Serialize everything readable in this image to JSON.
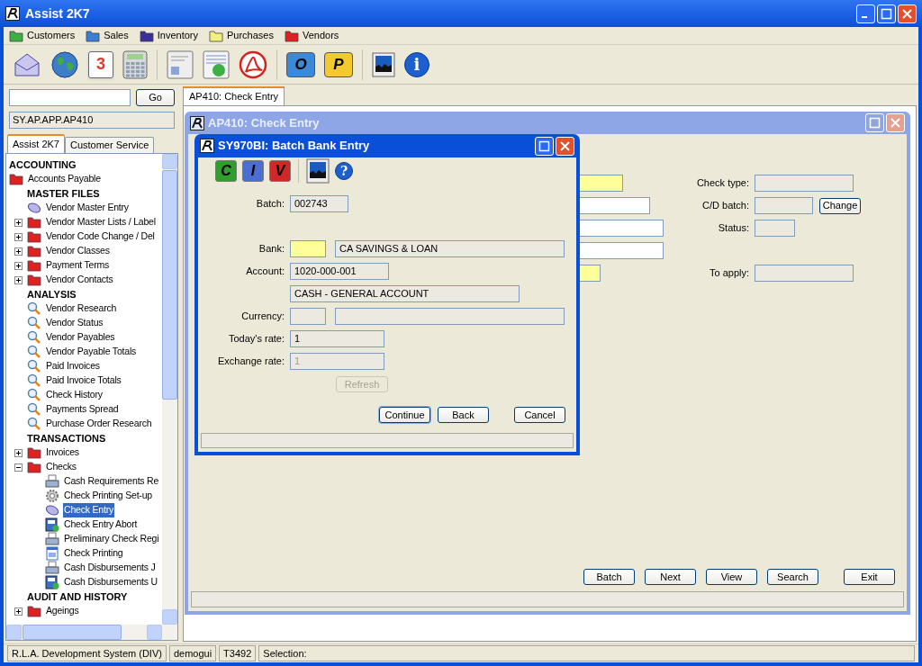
{
  "window": {
    "title": "Assist 2K7"
  },
  "menu": [
    {
      "label": "Customers",
      "color": "#3cb043"
    },
    {
      "label": "Sales",
      "color": "#3a7fd5"
    },
    {
      "label": "Inventory",
      "color": "#3b2f9c"
    },
    {
      "label": "Purchases",
      "color": "#f2ef7a"
    },
    {
      "label": "Vendors",
      "color": "#e02020"
    }
  ],
  "toolbar": [
    {
      "kind": "envelope"
    },
    {
      "kind": "globe"
    },
    {
      "kind": "calendar",
      "glyph": "3"
    },
    {
      "kind": "calculator"
    },
    {
      "kind": "card"
    },
    {
      "kind": "chart"
    },
    {
      "kind": "swirl"
    },
    {
      "kind": "folder",
      "glyph": "O"
    },
    {
      "kind": "folder",
      "glyph": "P"
    },
    {
      "kind": "picture"
    },
    {
      "kind": "info",
      "glyph": "i"
    }
  ],
  "search": {
    "button": "Go"
  },
  "path": "SY.AP.APP.AP410",
  "nav_tabs": [
    {
      "label": "Assist 2K7",
      "selected": true
    },
    {
      "label": "Customer Service",
      "selected": false
    }
  ],
  "tree": [
    {
      "label": "ACCOUNTING",
      "kind": "heading",
      "children": [
        {
          "label": "Accounts Payable",
          "kind": "folder",
          "selected": false,
          "children": [
            {
              "label": "MASTER FILES",
              "kind": "heading",
              "children": [
                {
                  "label": "Vendor Master Entry",
                  "kind": "entry",
                  "selected": false
                },
                {
                  "label": "Vendor Master Lists / Label",
                  "kind": "folder",
                  "selected": false,
                  "expanded": false
                },
                {
                  "label": "Vendor Code Change / Del",
                  "kind": "folder",
                  "selected": false,
                  "expanded": false
                },
                {
                  "label": "Vendor Classes",
                  "kind": "folder",
                  "selected": false,
                  "expanded": false
                },
                {
                  "label": "Payment Terms",
                  "kind": "folder",
                  "selected": false,
                  "expanded": false
                },
                {
                  "label": "Vendor Contacts",
                  "kind": "folder",
                  "selected": false,
                  "expanded": false
                }
              ]
            },
            {
              "label": "ANALYSIS",
              "kind": "heading",
              "children": [
                {
                  "label": "Vendor Research",
                  "kind": "search",
                  "selected": false
                },
                {
                  "label": "Vendor Status",
                  "kind": "search",
                  "selected": false
                },
                {
                  "label": "Vendor Payables",
                  "kind": "search",
                  "selected": false
                },
                {
                  "label": "Vendor Payable Totals",
                  "kind": "search",
                  "selected": false
                },
                {
                  "label": "Paid Invoices",
                  "kind": "search",
                  "selected": false
                },
                {
                  "label": "Paid Invoice Totals",
                  "kind": "search",
                  "selected": false
                },
                {
                  "label": "Check History",
                  "kind": "search",
                  "selected": false
                },
                {
                  "label": "Payments Spread",
                  "kind": "search",
                  "selected": false
                },
                {
                  "label": "Purchase Order Research",
                  "kind": "search",
                  "selected": false
                }
              ]
            },
            {
              "label": "TRANSACTIONS",
              "kind": "heading",
              "children": [
                {
                  "label": "Invoices",
                  "kind": "folder",
                  "selected": false,
                  "expanded": false
                },
                {
                  "label": "Checks",
                  "kind": "folder",
                  "selected": false,
                  "expanded": true,
                  "children": [
                    {
                      "label": "Cash Requirements Re",
                      "kind": "printer",
                      "selected": false
                    },
                    {
                      "label": "Check Printing Set-up",
                      "kind": "gear",
                      "selected": false
                    },
                    {
                      "label": "Check Entry",
                      "kind": "entry",
                      "selected": true
                    },
                    {
                      "label": "Check Entry Abort",
                      "kind": "form",
                      "selected": false
                    },
                    {
                      "label": "Preliminary Check Regi",
                      "kind": "printer",
                      "selected": false
                    },
                    {
                      "label": "Check Printing",
                      "kind": "window",
                      "selected": false
                    },
                    {
                      "label": "Cash Disbursements J",
                      "kind": "printer",
                      "selected": false
                    },
                    {
                      "label": "Cash Disbursements U",
                      "kind": "form",
                      "selected": false
                    }
                  ]
                }
              ]
            },
            {
              "label": "AUDIT AND HISTORY",
              "kind": "heading",
              "children": [
                {
                  "label": "Ageings",
                  "kind": "folder",
                  "selected": false,
                  "expanded": false
                }
              ]
            }
          ]
        }
      ]
    }
  ],
  "doc_tabs": [
    {
      "label": "AP410: Check Entry",
      "selected": true
    }
  ],
  "check_entry": {
    "title": "AP410: Check Entry",
    "rows": [
      {
        "required": true,
        "label": "Check type:"
      },
      {
        "required": false,
        "label": "C/D batch:",
        "button": "Change"
      },
      {
        "required": false,
        "label": "Status:"
      },
      {
        "required": false
      },
      {
        "required": true,
        "label": "To apply:"
      }
    ],
    "buttons": [
      "Batch",
      "Next",
      "View",
      "Search",
      "Exit"
    ]
  },
  "dialog": {
    "title": "SY970BI: Batch Bank Entry",
    "toolbar": [
      {
        "kind": "doc",
        "glyph": "C",
        "color": "#2f9e2f"
      },
      {
        "kind": "doc",
        "glyph": "I",
        "color": "#4a6fd0"
      },
      {
        "kind": "doc",
        "glyph": "V",
        "color": "#d02828"
      },
      {
        "kind": "picture"
      },
      {
        "kind": "help",
        "glyph": "?"
      }
    ],
    "rows": [
      {
        "label": "Batch:",
        "fields": [
          {
            "value": "002743",
            "required": false,
            "disabled": false
          }
        ]
      },
      {
        "label": "Bank:",
        "fields": [
          {
            "required": true,
            "disabled": false
          },
          {
            "value": "CA SAVINGS & LOAN",
            "required": false,
            "disabled": false
          }
        ]
      },
      {
        "label": "Account:",
        "fields": [
          {
            "value": "1020-000-001",
            "required": false,
            "disabled": false
          }
        ]
      },
      {
        "fields": [
          {
            "value": "CASH - GENERAL ACCOUNT",
            "required": false,
            "disabled": false
          }
        ]
      },
      {
        "label": "Currency:",
        "fields": [
          {
            "required": false
          },
          {
            "required": false
          }
        ]
      },
      {
        "label": "Today's rate:",
        "fields": [
          {
            "value": "1",
            "required": false,
            "disabled": false
          }
        ]
      },
      {
        "label": "Exchange rate:",
        "fields": [
          {
            "value": "1",
            "required": false,
            "disabled": true
          }
        ]
      }
    ],
    "refresh": {
      "label": "Refresh",
      "disabled": true
    },
    "buttons": [
      {
        "label": "Continue",
        "default": true
      },
      {
        "label": "Back",
        "default": false
      },
      {
        "label": "Cancel",
        "default": false
      }
    ]
  },
  "status_bar": [
    "R.L.A. Development System (DIV)",
    "demogui",
    "T3492",
    "Selection:"
  ]
}
